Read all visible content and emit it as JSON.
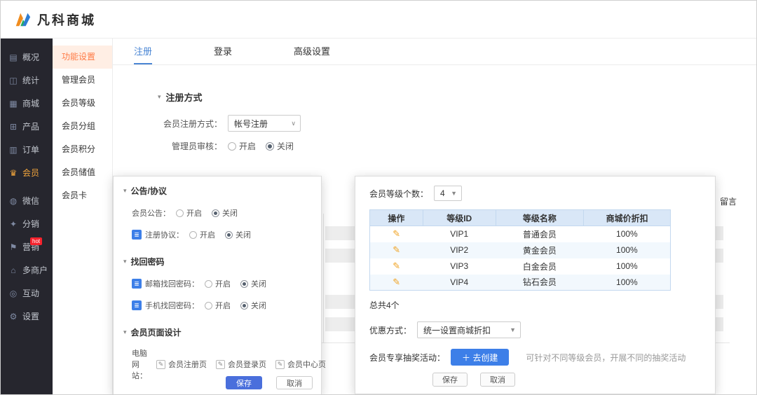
{
  "header": {
    "brand": "凡科商城"
  },
  "icons": {
    "collapse": "▾",
    "chevron_thin": "∨",
    "chevron_solid": "▼",
    "edit": "✎",
    "feature_lines": "≣"
  },
  "sidebar": {
    "items": [
      {
        "label": "概况",
        "glyph": "▤"
      },
      {
        "label": "统计",
        "glyph": "◫"
      },
      {
        "label": "商城",
        "glyph": "▦"
      },
      {
        "label": "产品",
        "glyph": "⊞"
      },
      {
        "label": "订单",
        "glyph": "▥"
      },
      {
        "label": "会员",
        "glyph": "♛",
        "active": true
      },
      {
        "label": "微信",
        "glyph": "◍"
      },
      {
        "label": "分销",
        "glyph": "✦"
      },
      {
        "label": "营销",
        "glyph": "⚑",
        "badge": "hot"
      },
      {
        "label": "多商户",
        "glyph": "⌂"
      },
      {
        "label": "互动",
        "glyph": "◎"
      },
      {
        "label": "设置",
        "glyph": "⚙"
      }
    ]
  },
  "submenu": {
    "items": [
      {
        "label": "功能设置",
        "active": true
      },
      {
        "label": "管理会员"
      },
      {
        "label": "会员等级"
      },
      {
        "label": "会员分组"
      },
      {
        "label": "会员积分"
      },
      {
        "label": "会员储值"
      },
      {
        "label": "会员卡"
      }
    ]
  },
  "tabs": [
    {
      "label": "注册",
      "active": true
    },
    {
      "label": "登录"
    },
    {
      "label": "高级设置"
    }
  ],
  "register": {
    "section_title": "注册方式",
    "reg_type_label": "会员注册方式：",
    "reg_type_value": "帐号注册",
    "admin_audit_label": "管理员审核：",
    "radio_on": "开启",
    "radio_off": "关闭",
    "selected": "关闭"
  },
  "left_panel": {
    "section1_title": "公告/协议",
    "row_notice_label": "会员公告：",
    "row_agreement_label": "注册协议：",
    "section2_title": "找回密码",
    "row_email_label": "邮箱找回密码：",
    "row_phone_label": "手机找回密码：",
    "section3_title": "会员页面设计",
    "pc_site_label": "电脑网站：",
    "design_links": [
      {
        "label": "会员注册页"
      },
      {
        "label": "会员登录页"
      },
      {
        "label": "会员中心页"
      }
    ],
    "radio_on": "开启",
    "radio_off": "关闭",
    "selected": "关闭",
    "save_label": "保存",
    "cancel_label": "取消"
  },
  "right_panel": {
    "level_count_label": "会员等级个数：",
    "level_count_value": "4",
    "table": {
      "headers": [
        "操作",
        "等级ID",
        "等级名称",
        "商城价折扣"
      ],
      "rows": [
        {
          "id": "VIP1",
          "name": "普通会员",
          "discount": "100%"
        },
        {
          "id": "VIP2",
          "name": "黄金会员",
          "discount": "100%"
        },
        {
          "id": "VIP3",
          "name": "白金会员",
          "discount": "100%"
        },
        {
          "id": "VIP4",
          "name": "钻石会员",
          "discount": "100%"
        }
      ]
    },
    "total_text": "总共4个",
    "discount_label": "优惠方式：",
    "discount_value": "统一设置商城折扣",
    "lottery_label": "会员专享抽奖活动：",
    "create_button": "＋ 去创建",
    "lottery_hint": "可针对不同等级会员，开展不同的抽奖活动",
    "save_label": "保存",
    "cancel_label": "取消"
  },
  "background": {
    "partial_text": "留言"
  },
  "colors": {
    "sidebar_bg": "#26262e",
    "accent_orange": "#f0a43c",
    "active_menu_orange": "#ff7a45",
    "active_menu_bg": "#ffeee4",
    "tab_blue": "#4a86d4",
    "table_header_bg": "#d9e7f7",
    "save_button_blue": "#4a6fdc",
    "create_button_blue": "#3d7fe8",
    "hot_badge_red": "#f5222d"
  }
}
